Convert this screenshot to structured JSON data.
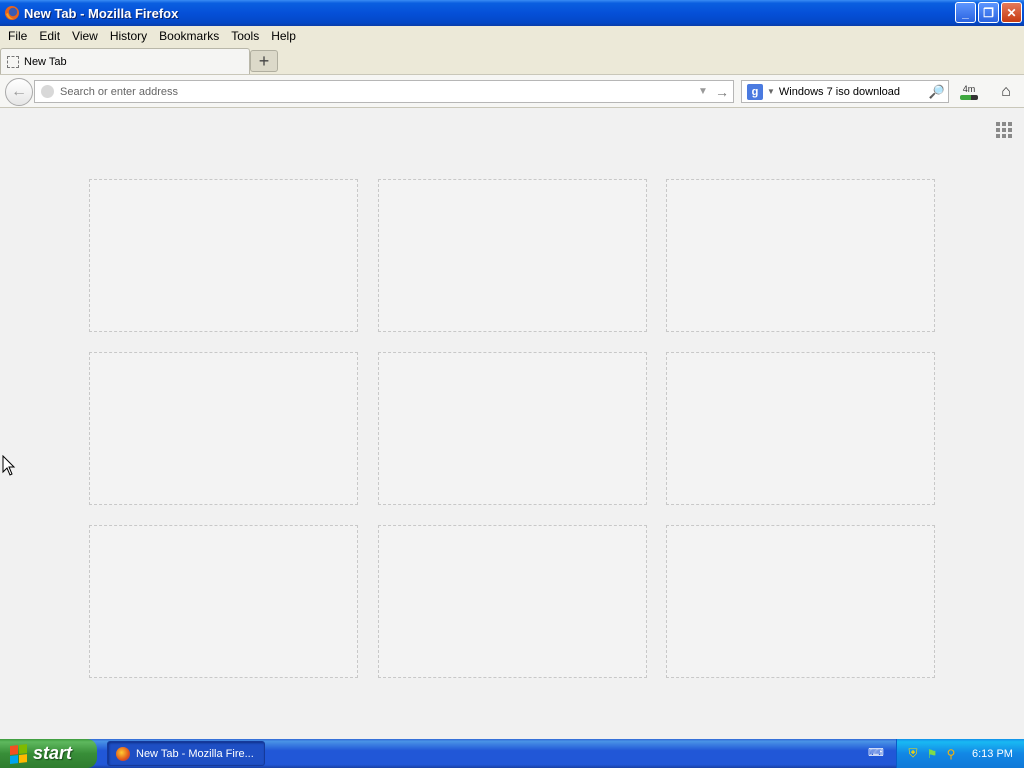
{
  "window": {
    "title": "New Tab - Mozilla Firefox"
  },
  "menu": {
    "items": [
      "File",
      "Edit",
      "View",
      "History",
      "Bookmarks",
      "Tools",
      "Help"
    ]
  },
  "tabs": [
    {
      "label": "New Tab"
    }
  ],
  "navbar": {
    "url_placeholder": "Search or enter address",
    "search_engine_letter": "g",
    "search_value": "Windows 7 iso download",
    "downloads_badge": "4m"
  },
  "taskbar": {
    "start_label": "start",
    "task_label": "New Tab - Mozilla Fire...",
    "clock": "6:13 PM"
  },
  "colors": {
    "title_bar": "#0550d8",
    "taskbar": "#2157d7",
    "start_button": "#388e38",
    "tray": "#1287e5"
  }
}
